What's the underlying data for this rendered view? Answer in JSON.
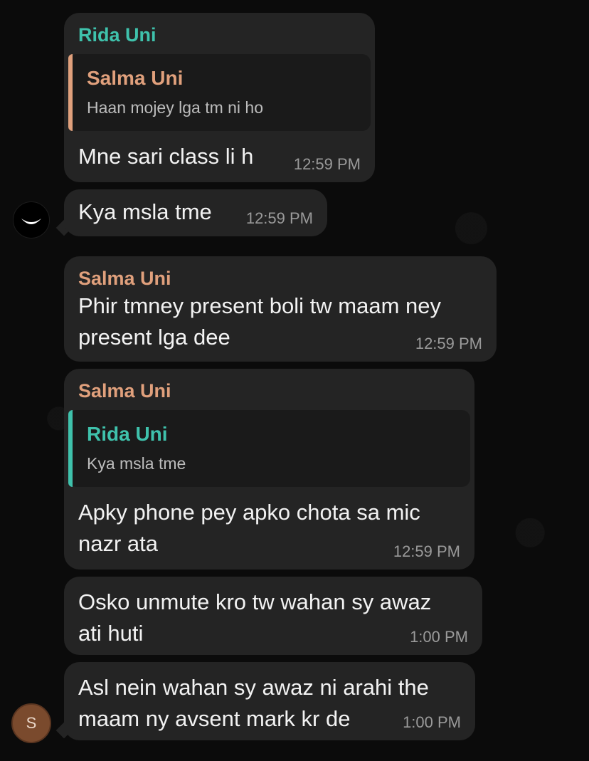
{
  "colors": {
    "rida": "#3fc2ac",
    "salma": "#e0a07c",
    "bubble": "#242424",
    "timestamp": "#9a9a9a",
    "avatar_s": "#7a4a2d"
  },
  "messages": [
    {
      "sender": "Rida Uni",
      "quote": {
        "name": "Salma Uni",
        "text": "Haan mojey lga tm ni ho"
      },
      "text": "Mne sari class li h",
      "time": "12:59 PM"
    },
    {
      "text": "Kya msla tme",
      "time": "12:59 PM"
    },
    {
      "sender": "Salma Uni",
      "text_lines": [
        "Phir tmney present boli tw maam ney",
        "present lga dee"
      ],
      "time": "12:59 PM"
    },
    {
      "sender": "Salma Uni",
      "quote": {
        "name": "Rida Uni",
        "text": "Kya msla tme"
      },
      "text_lines": [
        "Apky phone pey apko chota sa mic",
        "nazr ata"
      ],
      "time": "12:59 PM"
    },
    {
      "text_lines": [
        "Osko unmute kro tw wahan sy awaz",
        "ati huti"
      ],
      "time": "1:00 PM"
    },
    {
      "text_lines": [
        "Asl nein wahan sy awaz ni arahi the",
        "maam ny avsent mark kr de"
      ],
      "time": "1:00 PM"
    }
  ],
  "avatars": {
    "rida_icon": "crescent-moon-icon",
    "salma_initial": "S"
  }
}
